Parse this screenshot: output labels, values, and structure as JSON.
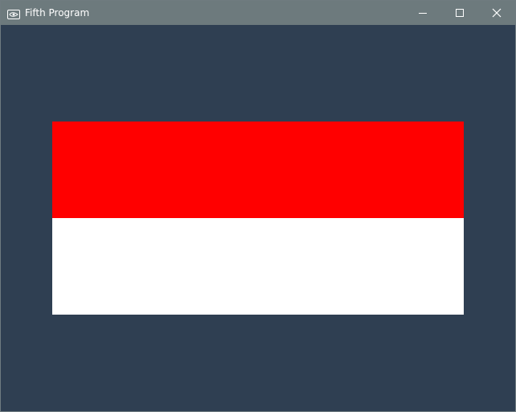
{
  "window": {
    "title": "Fifth Program",
    "icons": {
      "app": "app-icon",
      "minimize": "minimize-icon",
      "maximize": "maximize-icon",
      "close": "close-icon"
    }
  },
  "canvas": {
    "background_color": "#2f3f52",
    "flag": {
      "top_color": "#ff0000",
      "bottom_color": "#ffffff"
    }
  }
}
